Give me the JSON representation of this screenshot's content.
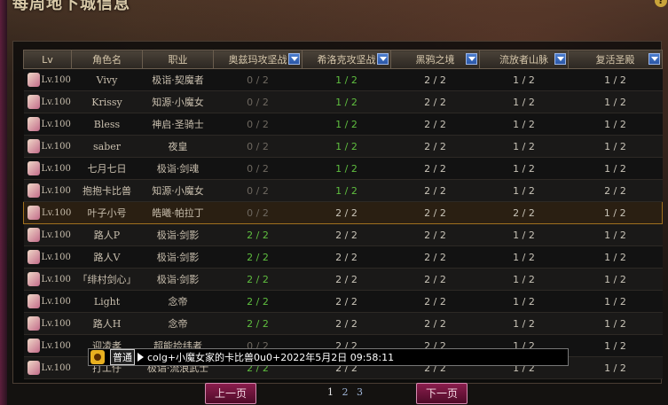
{
  "title": "每周地下城信息",
  "columns": [
    "Lv",
    "角色名",
    "职业",
    "奥兹玛攻坚战",
    "希洛克攻坚战",
    "黑鸦之境",
    "流放者山脉",
    "复活圣殿"
  ],
  "rows": [
    {
      "lv": "Lv.100",
      "name": "Vivy",
      "job": "极诣·契魔者",
      "c1": "0 / 2",
      "c2": "1 / 2",
      "c3": "2 / 2",
      "c4": "1 / 2",
      "c5": "1 / 2"
    },
    {
      "lv": "Lv.100",
      "name": "Krissy",
      "job": "知源·小魔女",
      "c1": "0 / 2",
      "c2": "1 / 2",
      "c3": "2 / 2",
      "c4": "1 / 2",
      "c5": "1 / 2"
    },
    {
      "lv": "Lv.100",
      "name": "Bless",
      "job": "神启·圣骑士",
      "c1": "0 / 2",
      "c2": "1 / 2",
      "c3": "2 / 2",
      "c4": "1 / 2",
      "c5": "1 / 2"
    },
    {
      "lv": "Lv.100",
      "name": "saber",
      "job": "夜皇",
      "c1": "0 / 2",
      "c2": "1 / 2",
      "c3": "2 / 2",
      "c4": "1 / 2",
      "c5": "1 / 2"
    },
    {
      "lv": "Lv.100",
      "name": "七月七日",
      "job": "极诣·剑魂",
      "c1": "0 / 2",
      "c2": "1 / 2",
      "c3": "2 / 2",
      "c4": "1 / 2",
      "c5": "1 / 2"
    },
    {
      "lv": "Lv.100",
      "name": "抱抱卡比兽",
      "job": "知源·小魔女",
      "c1": "0 / 2",
      "c2": "1 / 2",
      "c3": "2 / 2",
      "c4": "1 / 2",
      "c5": "2 / 2"
    },
    {
      "lv": "Lv.100",
      "name": "叶子小号",
      "job": "皓曦·帕拉丁",
      "c1": "0 / 2",
      "c2": "2 / 2",
      "c3": "2 / 2",
      "c4": "2 / 2",
      "c5": "1 / 2"
    },
    {
      "lv": "Lv.100",
      "name": "路人P",
      "job": "极诣·剑影",
      "c1": "2 / 2",
      "c2": "2 / 2",
      "c3": "2 / 2",
      "c4": "1 / 2",
      "c5": "1 / 2"
    },
    {
      "lv": "Lv.100",
      "name": "路人V",
      "job": "极诣·剑影",
      "c1": "2 / 2",
      "c2": "2 / 2",
      "c3": "2 / 2",
      "c4": "1 / 2",
      "c5": "1 / 2"
    },
    {
      "lv": "Lv.100",
      "name": "「绯村剑心」",
      "job": "极诣·剑影",
      "c1": "2 / 2",
      "c2": "2 / 2",
      "c3": "2 / 2",
      "c4": "1 / 2",
      "c5": "1 / 2"
    },
    {
      "lv": "Lv.100",
      "name": "Light",
      "job": "念帝",
      "c1": "2 / 2",
      "c2": "2 / 2",
      "c3": "2 / 2",
      "c4": "1 / 2",
      "c5": "1 / 2"
    },
    {
      "lv": "Lv.100",
      "name": "路人H",
      "job": "念帝",
      "c1": "2 / 2",
      "c2": "2 / 2",
      "c3": "2 / 2",
      "c4": "1 / 2",
      "c5": "1 / 2"
    },
    {
      "lv": "Lv.100",
      "name": "迎凌孝",
      "job": "超能捡纬者",
      "c1": "0 / 2",
      "c2": "2 / 2",
      "c3": "2 / 2",
      "c4": "1 / 2",
      "c5": "1 / 2"
    },
    {
      "lv": "Lv.100",
      "name": "打工仔",
      "job": "极诣·流浪武士",
      "c1": "2 / 2",
      "c2": "2 / 2",
      "c3": "2 / 2",
      "c4": "1 / 2",
      "c5": "1 / 2"
    }
  ],
  "chat": {
    "mode": "普通",
    "text": "colg+小魔女家的卡比兽0u0+2022年5月2日 09:58:11"
  },
  "pager": {
    "prev": "上一页",
    "next": "下一页",
    "pages": [
      "1",
      "2",
      "3"
    ]
  }
}
